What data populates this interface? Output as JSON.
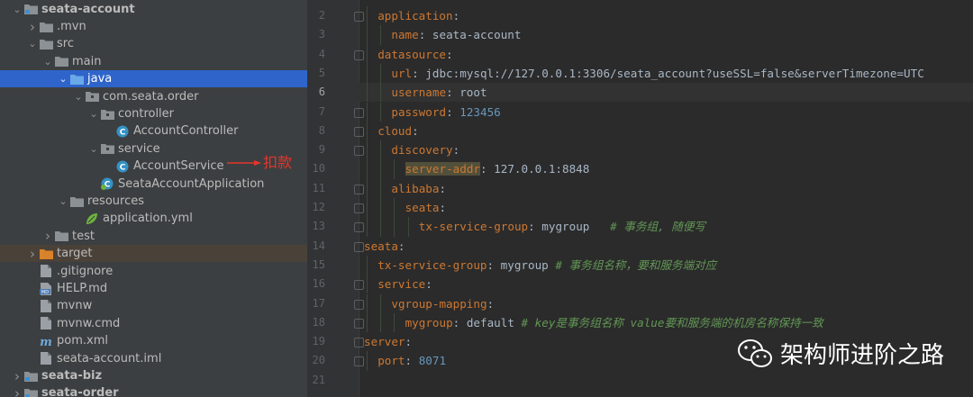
{
  "tree": [
    {
      "indent": 0,
      "arrow": "down",
      "icon": "module",
      "label": "seata-account",
      "bold": true
    },
    {
      "indent": 1,
      "arrow": "right",
      "icon": "folder",
      "label": ".mvn"
    },
    {
      "indent": 1,
      "arrow": "down",
      "icon": "folder",
      "label": "src"
    },
    {
      "indent": 2,
      "arrow": "down",
      "icon": "folder",
      "label": "main"
    },
    {
      "indent": 3,
      "arrow": "down",
      "icon": "folder-blue",
      "label": "java",
      "selected": true
    },
    {
      "indent": 4,
      "arrow": "down",
      "icon": "package",
      "label": "com.seata.order"
    },
    {
      "indent": 5,
      "arrow": "down",
      "icon": "package",
      "label": "controller"
    },
    {
      "indent": 6,
      "arrow": "none",
      "icon": "class",
      "label": "AccountController"
    },
    {
      "indent": 5,
      "arrow": "down",
      "icon": "package",
      "label": "service"
    },
    {
      "indent": 6,
      "arrow": "none",
      "icon": "class",
      "label": "AccountService"
    },
    {
      "indent": 5,
      "arrow": "none",
      "icon": "spring-class",
      "label": "SeataAccountApplication"
    },
    {
      "indent": 3,
      "arrow": "down",
      "icon": "folder",
      "label": "resources"
    },
    {
      "indent": 4,
      "arrow": "none",
      "icon": "yml",
      "label": "application.yml"
    },
    {
      "indent": 2,
      "arrow": "right",
      "icon": "folder",
      "label": "test"
    },
    {
      "indent": 1,
      "arrow": "right",
      "icon": "folder-orange",
      "label": "target",
      "target": true
    },
    {
      "indent": 1,
      "arrow": "none",
      "icon": "file",
      "label": ".gitignore"
    },
    {
      "indent": 1,
      "arrow": "none",
      "icon": "md",
      "label": "HELP.md"
    },
    {
      "indent": 1,
      "arrow": "none",
      "icon": "file",
      "label": "mvnw"
    },
    {
      "indent": 1,
      "arrow": "none",
      "icon": "file",
      "label": "mvnw.cmd"
    },
    {
      "indent": 1,
      "arrow": "none",
      "icon": "maven",
      "label": "pom.xml"
    },
    {
      "indent": 1,
      "arrow": "none",
      "icon": "file",
      "label": "seata-account.iml"
    },
    {
      "indent": 0,
      "arrow": "right",
      "icon": "module",
      "label": "seata-biz",
      "bold": true
    },
    {
      "indent": 0,
      "arrow": "right",
      "icon": "module",
      "label": "seata-order",
      "bold": true
    }
  ],
  "annotation": {
    "label": "扣款"
  },
  "editor": {
    "current_line": 6,
    "lines": [
      {
        "n": "2",
        "indent": 1,
        "fold": true,
        "parts": [
          {
            "t": "application",
            "c": "k"
          },
          {
            "t": ":",
            "c": "v"
          }
        ]
      },
      {
        "n": "3",
        "indent": 2,
        "parts": [
          {
            "t": "name",
            "c": "k"
          },
          {
            "t": ": seata-account",
            "c": "v"
          }
        ]
      },
      {
        "n": "4",
        "indent": 1,
        "fold": true,
        "parts": [
          {
            "t": "datasource",
            "c": "k"
          },
          {
            "t": ":",
            "c": "v"
          }
        ]
      },
      {
        "n": "5",
        "indent": 2,
        "parts": [
          {
            "t": "url",
            "c": "k"
          },
          {
            "t": ": jdbc:mysql://127.0.0.1:3306/seata_account?useSSL=false&serverTimezone=UTC",
            "c": "v"
          }
        ]
      },
      {
        "n": "6",
        "indent": 2,
        "parts": [
          {
            "t": "username",
            "c": "k"
          },
          {
            "t": ": root",
            "c": "v"
          }
        ]
      },
      {
        "n": "7",
        "indent": 2,
        "fold": true,
        "parts": [
          {
            "t": "password",
            "c": "k"
          },
          {
            "t": ": ",
            "c": "v"
          },
          {
            "t": "123456",
            "c": "num"
          }
        ]
      },
      {
        "n": "8",
        "indent": 1,
        "fold": true,
        "parts": [
          {
            "t": "cloud",
            "c": "k"
          },
          {
            "t": ":",
            "c": "v"
          }
        ]
      },
      {
        "n": "9",
        "indent": 2,
        "fold": true,
        "parts": [
          {
            "t": "discovery",
            "c": "k"
          },
          {
            "t": ":",
            "c": "v"
          }
        ]
      },
      {
        "n": "10",
        "indent": 3,
        "parts": [
          {
            "t": "server-addr",
            "c": "k hl"
          },
          {
            "t": ": 127.0.0.1:8848",
            "c": "v"
          }
        ]
      },
      {
        "n": "11",
        "indent": 2,
        "fold": true,
        "parts": [
          {
            "t": "alibaba",
            "c": "k"
          },
          {
            "t": ":",
            "c": "v"
          }
        ]
      },
      {
        "n": "12",
        "indent": 3,
        "fold": true,
        "parts": [
          {
            "t": "seata",
            "c": "k"
          },
          {
            "t": ":",
            "c": "v"
          }
        ]
      },
      {
        "n": "13",
        "indent": 4,
        "fold": true,
        "parts": [
          {
            "t": "tx-service-group",
            "c": "k"
          },
          {
            "t": ": mygroup   ",
            "c": "v"
          },
          {
            "t": "# 事务组, 随便写",
            "c": "c"
          }
        ]
      },
      {
        "n": "14",
        "indent": 0,
        "fold": true,
        "parts": [
          {
            "t": "seata",
            "c": "k"
          },
          {
            "t": ":",
            "c": "v"
          }
        ]
      },
      {
        "n": "15",
        "indent": 1,
        "parts": [
          {
            "t": "tx-service-group",
            "c": "k"
          },
          {
            "t": ": mygroup ",
            "c": "v"
          },
          {
            "t": "# 事务组名称，要和服务端对应",
            "c": "c"
          }
        ]
      },
      {
        "n": "16",
        "indent": 1,
        "fold": true,
        "parts": [
          {
            "t": "service",
            "c": "k"
          },
          {
            "t": ":",
            "c": "v"
          }
        ]
      },
      {
        "n": "17",
        "indent": 2,
        "fold": true,
        "parts": [
          {
            "t": "vgroup-mapping",
            "c": "k"
          },
          {
            "t": ":",
            "c": "v"
          }
        ]
      },
      {
        "n": "18",
        "indent": 3,
        "fold": true,
        "parts": [
          {
            "t": "mygroup",
            "c": "k"
          },
          {
            "t": ": default ",
            "c": "v"
          },
          {
            "t": "# key是事务组名称 value要和服务端的机房名称保持一致",
            "c": "c"
          }
        ]
      },
      {
        "n": "19",
        "indent": 0,
        "fold": true,
        "parts": [
          {
            "t": "server",
            "c": "k"
          },
          {
            "t": ":",
            "c": "v"
          }
        ]
      },
      {
        "n": "20",
        "indent": 1,
        "fold": true,
        "parts": [
          {
            "t": "port",
            "c": "k"
          },
          {
            "t": ": ",
            "c": "v"
          },
          {
            "t": "8071",
            "c": "num"
          }
        ]
      },
      {
        "n": "21",
        "indent": 0,
        "parts": []
      }
    ]
  },
  "watermark": {
    "text": "架构师进阶之路"
  },
  "colors": {
    "sidebar_bg": "#3c3f41",
    "editor_bg": "#2b2b2b",
    "selection": "#2f65ca",
    "keyword": "#cc7832",
    "comment": "#629755",
    "number": "#6897bb",
    "annotation": "#e5352b"
  }
}
